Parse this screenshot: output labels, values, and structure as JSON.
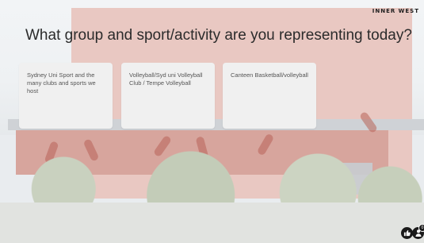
{
  "slide": {
    "question": "What group and sport/activity are you representing today?",
    "logo_text": "INNER WEST"
  },
  "responses": [
    {
      "text": "Sydney Uni Sport and the many clubs and sports we host"
    },
    {
      "text": "Volleyball/Syd uni Volleyball Club / Tempe Volleyball"
    },
    {
      "text": "Canteen Basketball/volleyball"
    }
  ],
  "controls": {
    "like_icon": "thumbs-up-icon",
    "people_icon": "person-icon",
    "people_count": "0"
  },
  "colors": {
    "card_bg": "#f0f0f0",
    "question_text": "#2b2b2b",
    "control_bg": "#1a1a1a"
  }
}
